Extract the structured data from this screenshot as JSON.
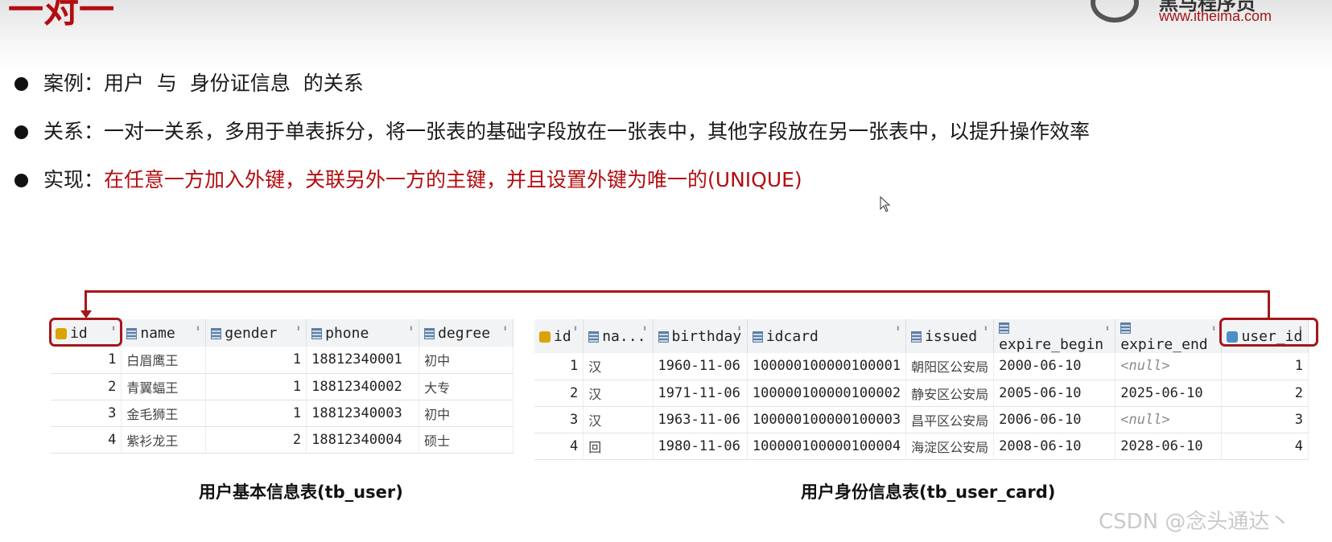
{
  "slide": {
    "title": "一对一",
    "logo_brand": "黑马程序员",
    "logo_url": "www.itheima.com"
  },
  "bullets": [
    {
      "label": "案例：",
      "text": "用户  与  身份证信息  的关系"
    },
    {
      "label": "关系：",
      "text": "一对一关系，多用于单表拆分，将一张表的基础字段放在一张表中，其他字段放在另一张表中，以提升操作效率"
    },
    {
      "label": "实现：",
      "text": "在任意一方加入外键，关联另外一方的主键，并且设置外键为唯一的(UNIQUE)"
    }
  ],
  "tb_user": {
    "caption": "用户基本信息表(tb_user)",
    "columns": [
      "id",
      "name",
      "gender",
      "phone",
      "degree"
    ],
    "rows": [
      [
        "1",
        "白眉鹰王",
        "1",
        "18812340001",
        "初中"
      ],
      [
        "2",
        "青翼蝠王",
        "1",
        "18812340002",
        "大专"
      ],
      [
        "3",
        "金毛狮王",
        "1",
        "18812340003",
        "初中"
      ],
      [
        "4",
        "紫衫龙王",
        "2",
        "18812340004",
        "硕士"
      ]
    ]
  },
  "tb_user_card": {
    "caption": "用户身份信息表(tb_user_card)",
    "columns": [
      "id",
      "na...",
      "birthday",
      "idcard",
      "issued",
      "expire_begin",
      "expire_end",
      "user_id"
    ],
    "rows": [
      [
        "1",
        "汉",
        "1960-11-06",
        "100000100000100001",
        "朝阳区公安局",
        "2000-06-10",
        "<null>",
        "1"
      ],
      [
        "2",
        "汉",
        "1971-11-06",
        "100000100000100002",
        "静安区公安局",
        "2005-06-10",
        "2025-06-10",
        "2"
      ],
      [
        "3",
        "汉",
        "1963-11-06",
        "100000100000100003",
        "昌平区公安局",
        "2006-06-10",
        "<null>",
        "3"
      ],
      [
        "4",
        "回",
        "1980-11-06",
        "100000100000100004",
        "海淀区公安局",
        "2008-06-10",
        "2028-06-10",
        "4"
      ]
    ]
  },
  "watermark": "CSDN @念头通达丶",
  "colors": {
    "accent_red": "#b40c10",
    "connector": "#a5161a"
  }
}
